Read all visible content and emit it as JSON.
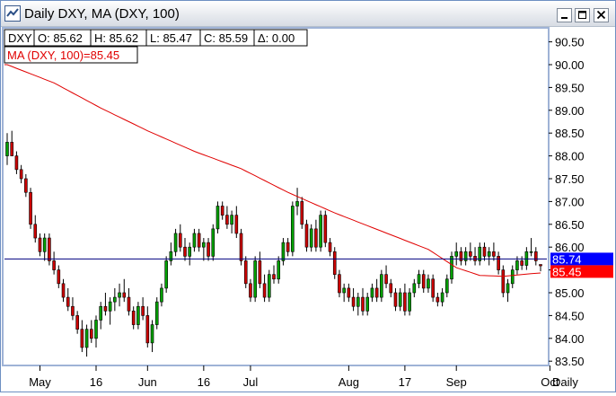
{
  "window": {
    "title": "Daily DXY, MA (DXY, 100)",
    "buttons": {
      "minimize": "minimize-icon",
      "maximize": "maximize-icon",
      "close": "close-icon"
    }
  },
  "ohlc_legend": {
    "symbol": "DXY",
    "open": "O: 85.62",
    "high": "H: 85.62",
    "low": "L: 85.47",
    "close": "C: 85.59",
    "delta": "Δ: 0.00"
  },
  "ma_legend": "MA (DXY, 100)=85.45",
  "price_tags": {
    "last": "85.74",
    "ma": "85.45"
  },
  "colors": {
    "up": "#00a000",
    "down": "#cc0000",
    "ma": "#e00000",
    "price_line": "#000080",
    "last_tag": "#0000ff",
    "ma_tag": "#ff0000",
    "frame": "#9fb3d6"
  },
  "chart_data": {
    "type": "candlestick",
    "y_range": [
      83.4,
      90.8
    ],
    "yticks": [
      "90.50",
      "90.00",
      "89.50",
      "89.00",
      "88.50",
      "88.00",
      "87.50",
      "87.00",
      "86.50",
      "86.00",
      "85.50",
      "85.00",
      "84.50",
      "84.00",
      "83.50"
    ],
    "ytick_values": [
      90.5,
      90.0,
      89.5,
      89.0,
      88.5,
      88.0,
      87.5,
      87.0,
      86.5,
      86.0,
      85.5,
      85.0,
      84.5,
      84.0,
      83.5
    ],
    "xticks": [
      {
        "label": "May",
        "bar": 7
      },
      {
        "label": "16",
        "bar": 19
      },
      {
        "label": "Jun",
        "bar": 30
      },
      {
        "label": "16",
        "bar": 42
      },
      {
        "label": "Jul",
        "bar": 52
      },
      {
        "label": "Aug",
        "bar": 73
      },
      {
        "label": "17",
        "bar": 85
      },
      {
        "label": "Sep",
        "bar": 96
      },
      {
        "label": "Oct",
        "bar": 116
      }
    ],
    "x_axis_label": "Daily",
    "last_price": 85.74,
    "ma_last": 85.45,
    "ohlc": [
      [
        88.0,
        88.5,
        87.8,
        88.3
      ],
      [
        88.3,
        88.55,
        88.1,
        88.0
      ],
      [
        88.0,
        88.1,
        87.6,
        87.7
      ],
      [
        87.7,
        87.8,
        87.4,
        87.5
      ],
      [
        87.5,
        87.6,
        87.1,
        87.2
      ],
      [
        87.2,
        87.3,
        86.4,
        86.5
      ],
      [
        86.5,
        86.7,
        86.1,
        86.2
      ],
      [
        86.2,
        86.3,
        85.8,
        85.9
      ],
      [
        85.9,
        86.3,
        85.7,
        86.2
      ],
      [
        86.2,
        86.3,
        85.6,
        85.7
      ],
      [
        85.7,
        85.9,
        85.4,
        85.5
      ],
      [
        85.5,
        85.6,
        85.1,
        85.2
      ],
      [
        85.2,
        85.3,
        84.8,
        84.9
      ],
      [
        84.9,
        85.1,
        84.6,
        84.7
      ],
      [
        84.7,
        84.9,
        84.4,
        84.5
      ],
      [
        84.5,
        84.6,
        84.1,
        84.2
      ],
      [
        84.2,
        84.4,
        83.7,
        83.8
      ],
      [
        83.8,
        84.3,
        83.6,
        84.2
      ],
      [
        84.2,
        84.4,
        83.9,
        84.0
      ],
      [
        84.0,
        84.5,
        83.8,
        84.4
      ],
      [
        84.4,
        84.8,
        84.2,
        84.7
      ],
      [
        84.7,
        85.0,
        84.5,
        84.6
      ],
      [
        84.6,
        84.9,
        84.3,
        84.8
      ],
      [
        84.8,
        85.1,
        84.6,
        84.9
      ],
      [
        84.9,
        85.2,
        84.7,
        85.0
      ],
      [
        85.0,
        85.3,
        84.8,
        84.9
      ],
      [
        84.9,
        85.1,
        84.5,
        84.6
      ],
      [
        84.6,
        84.7,
        84.2,
        84.3
      ],
      [
        84.3,
        84.8,
        84.2,
        84.7
      ],
      [
        84.7,
        84.9,
        84.4,
        84.5
      ],
      [
        84.5,
        84.7,
        83.8,
        83.9
      ],
      [
        83.9,
        84.4,
        83.7,
        84.3
      ],
      [
        84.3,
        84.9,
        84.2,
        84.8
      ],
      [
        84.8,
        85.2,
        84.7,
        85.1
      ],
      [
        85.1,
        85.8,
        85.0,
        85.7
      ],
      [
        85.7,
        86.1,
        85.6,
        85.9
      ],
      [
        85.9,
        86.4,
        85.8,
        86.3
      ],
      [
        86.3,
        86.5,
        85.9,
        86.0
      ],
      [
        86.0,
        86.2,
        85.7,
        85.8
      ],
      [
        85.8,
        86.1,
        85.6,
        86.0
      ],
      [
        86.0,
        86.4,
        85.9,
        86.3
      ],
      [
        86.3,
        86.4,
        85.9,
        86.0
      ],
      [
        86.0,
        86.2,
        85.7,
        86.1
      ],
      [
        86.1,
        86.2,
        85.7,
        85.8
      ],
      [
        85.8,
        86.5,
        85.7,
        86.4
      ],
      [
        86.4,
        87.0,
        86.3,
        86.9
      ],
      [
        86.9,
        87.0,
        86.6,
        86.7
      ],
      [
        86.7,
        86.9,
        86.4,
        86.5
      ],
      [
        86.5,
        86.8,
        86.3,
        86.7
      ],
      [
        86.7,
        86.9,
        86.2,
        86.3
      ],
      [
        86.3,
        86.4,
        85.6,
        85.7
      ],
      [
        85.7,
        85.8,
        85.1,
        85.2
      ],
      [
        85.2,
        85.3,
        84.8,
        84.9
      ],
      [
        84.9,
        85.8,
        84.8,
        85.7
      ],
      [
        85.7,
        85.9,
        85.1,
        85.2
      ],
      [
        85.2,
        85.4,
        84.8,
        84.9
      ],
      [
        84.9,
        85.5,
        84.8,
        85.4
      ],
      [
        85.4,
        85.6,
        85.2,
        85.3
      ],
      [
        85.3,
        85.8,
        85.2,
        85.7
      ],
      [
        85.7,
        86.2,
        85.6,
        86.1
      ],
      [
        86.1,
        86.2,
        85.8,
        85.9
      ],
      [
        85.9,
        87.0,
        85.8,
        86.9
      ],
      [
        86.9,
        87.3,
        86.7,
        87.0
      ],
      [
        87.0,
        87.1,
        86.4,
        86.5
      ],
      [
        86.5,
        86.6,
        85.9,
        86.0
      ],
      [
        86.0,
        86.5,
        85.9,
        86.4
      ],
      [
        86.4,
        86.6,
        85.9,
        86.0
      ],
      [
        86.0,
        86.8,
        85.9,
        86.7
      ],
      [
        86.7,
        86.8,
        86.0,
        86.1
      ],
      [
        86.1,
        86.2,
        85.8,
        85.9
      ],
      [
        85.9,
        86.0,
        85.3,
        85.4
      ],
      [
        85.4,
        85.5,
        84.9,
        85.0
      ],
      [
        85.0,
        85.2,
        84.8,
        85.1
      ],
      [
        85.1,
        85.2,
        84.8,
        84.9
      ],
      [
        84.9,
        85.1,
        84.6,
        84.7
      ],
      [
        84.7,
        85.0,
        84.5,
        84.9
      ],
      [
        84.9,
        85.1,
        84.5,
        84.6
      ],
      [
        84.6,
        85.0,
        84.5,
        84.9
      ],
      [
        84.9,
        85.2,
        84.8,
        85.1
      ],
      [
        85.1,
        85.3,
        84.8,
        84.9
      ],
      [
        84.9,
        85.5,
        84.8,
        85.4
      ],
      [
        85.4,
        85.6,
        85.1,
        85.2
      ],
      [
        85.2,
        85.3,
        84.9,
        85.0
      ],
      [
        85.0,
        85.1,
        84.6,
        84.7
      ],
      [
        84.7,
        85.1,
        84.6,
        85.0
      ],
      [
        85.0,
        85.2,
        84.5,
        84.6
      ],
      [
        84.6,
        85.1,
        84.5,
        85.0
      ],
      [
        85.0,
        85.3,
        84.9,
        85.2
      ],
      [
        85.2,
        85.5,
        85.1,
        85.4
      ],
      [
        85.4,
        85.5,
        85.0,
        85.1
      ],
      [
        85.1,
        85.4,
        85.0,
        85.3
      ],
      [
        85.3,
        85.4,
        84.8,
        84.9
      ],
      [
        84.9,
        85.0,
        84.7,
        84.8
      ],
      [
        84.8,
        85.1,
        84.7,
        85.0
      ],
      [
        85.0,
        85.4,
        84.9,
        85.3
      ],
      [
        85.3,
        85.9,
        85.2,
        85.8
      ],
      [
        85.8,
        86.1,
        85.6,
        85.9
      ],
      [
        85.9,
        86.0,
        85.6,
        85.7
      ],
      [
        85.7,
        86.0,
        85.6,
        85.9
      ],
      [
        85.9,
        86.1,
        85.7,
        85.8
      ],
      [
        85.8,
        86.0,
        85.6,
        85.7
      ],
      [
        85.7,
        86.1,
        85.6,
        86.0
      ],
      [
        86.0,
        86.1,
        85.7,
        85.8
      ],
      [
        85.8,
        86.0,
        85.6,
        85.9
      ],
      [
        85.9,
        86.1,
        85.7,
        85.8
      ],
      [
        85.8,
        85.9,
        85.4,
        85.5
      ],
      [
        85.5,
        85.6,
        84.9,
        85.0
      ],
      [
        85.0,
        85.3,
        84.8,
        85.2
      ],
      [
        85.2,
        85.6,
        85.1,
        85.5
      ],
      [
        85.5,
        85.8,
        85.4,
        85.7
      ],
      [
        85.7,
        85.8,
        85.5,
        85.6
      ],
      [
        85.6,
        86.0,
        85.5,
        85.9
      ],
      [
        85.9,
        86.2,
        85.8,
        85.9
      ],
      [
        85.9,
        86.0,
        85.6,
        85.7
      ],
      [
        85.62,
        85.62,
        85.47,
        85.59
      ]
    ],
    "ma_anchors": [
      [
        0,
        90.0
      ],
      [
        10,
        89.6
      ],
      [
        20,
        89.05
      ],
      [
        30,
        88.55
      ],
      [
        40,
        88.1
      ],
      [
        50,
        87.72
      ],
      [
        60,
        87.2
      ],
      [
        70,
        86.75
      ],
      [
        80,
        86.35
      ],
      [
        90,
        85.95
      ],
      [
        96,
        85.55
      ],
      [
        101,
        85.38
      ],
      [
        106,
        85.36
      ],
      [
        110,
        85.4
      ],
      [
        116,
        85.45
      ]
    ]
  }
}
